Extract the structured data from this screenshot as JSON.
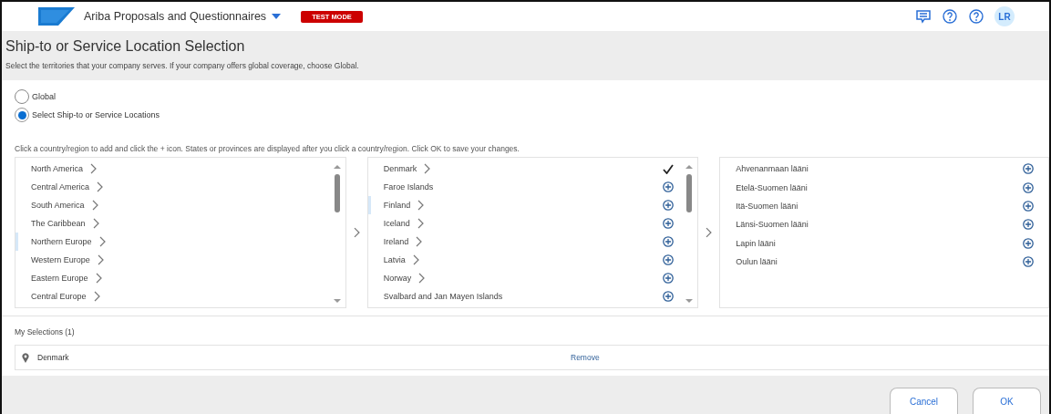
{
  "header": {
    "app_title": "Ariba Proposals and Questionnaires",
    "badge": "TEST MODE",
    "avatar": "LR"
  },
  "page": {
    "title": "Ship-to or Service Location Selection",
    "subtitle": "Select the territories that your company serves. If your company offers global coverage, choose Global."
  },
  "coverage": [
    {
      "label": "Global",
      "selected": false
    },
    {
      "label": "Select Ship-to or Service Locations",
      "selected": true
    }
  ],
  "instruction": "Click a country/region to add and click the + icon. States or provinces are displayed after you click a country/region. Click OK to save your changes.",
  "columns": [
    {
      "items": [
        {
          "label": "North America",
          "has_children": true,
          "selected": false
        },
        {
          "label": "Central America",
          "has_children": true,
          "selected": false
        },
        {
          "label": "South America",
          "has_children": true,
          "selected": false
        },
        {
          "label": "The Caribbean",
          "has_children": true,
          "selected": false
        },
        {
          "label": "Northern Europe",
          "has_children": true,
          "selected": true
        },
        {
          "label": "Western Europe",
          "has_children": true,
          "selected": false
        },
        {
          "label": "Eastern Europe",
          "has_children": true,
          "selected": false
        },
        {
          "label": "Central Europe",
          "has_children": true,
          "selected": false
        }
      ]
    },
    {
      "items": [
        {
          "label": "Denmark",
          "has_children": true,
          "selected": false,
          "added": true
        },
        {
          "label": "Faroe Islands",
          "has_children": false,
          "selected": false,
          "added": false
        },
        {
          "label": "Finland",
          "has_children": true,
          "selected": true,
          "added": false
        },
        {
          "label": "Iceland",
          "has_children": true,
          "selected": false,
          "added": false
        },
        {
          "label": "Ireland",
          "has_children": true,
          "selected": false,
          "added": false
        },
        {
          "label": "Latvia",
          "has_children": true,
          "selected": false,
          "added": false
        },
        {
          "label": "Norway",
          "has_children": true,
          "selected": false,
          "added": false
        },
        {
          "label": "Svalbard and Jan Mayen Islands",
          "has_children": false,
          "selected": false,
          "added": false
        }
      ]
    },
    {
      "items": [
        {
          "label": "Ahvenanmaan lääni",
          "added": false
        },
        {
          "label": "Etelä-Suomen lääni",
          "added": false
        },
        {
          "label": "Itä-Suomen lääni",
          "added": false
        },
        {
          "label": "Länsi-Suomen lääni",
          "added": false
        },
        {
          "label": "Lapin lääni",
          "added": false
        },
        {
          "label": "Oulun lääni",
          "added": false
        }
      ]
    }
  ],
  "my_selections": {
    "title": "My Selections (1)",
    "items": [
      {
        "label": "Denmark",
        "action": "Remove"
      }
    ]
  },
  "buttons": [
    {
      "label": "Cancel"
    },
    {
      "label": "OK"
    }
  ]
}
